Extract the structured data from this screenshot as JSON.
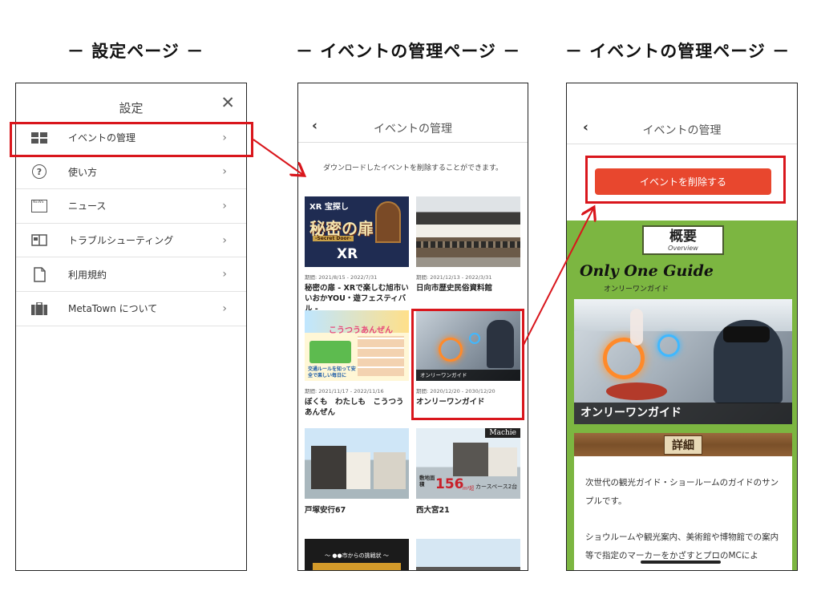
{
  "headings": {
    "settings": "－ 設定ページ －",
    "event_mgmt_1": "－ イベントの管理ページ －",
    "event_mgmt_2": "－ イベントの管理ページ －"
  },
  "settings": {
    "title": "設定",
    "close_icon": "close-icon",
    "menu": [
      {
        "label": "イベントの管理",
        "icon": "grid-icon"
      },
      {
        "label": "使い方",
        "icon": "help-circle-icon",
        "glyph": "?"
      },
      {
        "label": "ニュース",
        "icon": "news-icon",
        "glyph": "NEWS"
      },
      {
        "label": "トラブルシューティング",
        "icon": "book-icon"
      },
      {
        "label": "利用規約",
        "icon": "document-icon"
      },
      {
        "label": "MetaTown について",
        "icon": "briefcase-icon"
      }
    ],
    "chevron": "›"
  },
  "events": {
    "back": "‹",
    "title": "イベントの管理",
    "description": "ダウンロードしたイベントを削除することができます。",
    "cards": [
      {
        "period": "期間: 2021/8/15 - 2022/7/31",
        "title": "秘密の扉 - XRで楽しむ旭市いいおかYOU・遊フェスティバル -",
        "thumb": {
          "top": "XR 宝探し",
          "main": "秘密の扉",
          "sub": "-Secret Door-",
          "xr": "XR"
        }
      },
      {
        "period": "期間: 2021/12/13 - 2022/3/31",
        "title": "日向市歴史民俗資料館"
      },
      {
        "period": "期間: 2021/11/17 - 2022/11/16",
        "title": "ぼくも　わたしも　こうつうあんぜん",
        "thumb": {
          "main": "こうつうあんぜん",
          "sub": "交通ルールを知って安全で楽しい毎日に"
        }
      },
      {
        "period": "期間: 2020/12/20 - 2030/12/20",
        "title": "オンリーワンガイド",
        "thumb": {
          "caption": "オンリーワンガイド"
        }
      },
      {
        "title": "戸塚安行67"
      },
      {
        "title": "西大宮21",
        "thumb": {
          "brand": "Machie",
          "area_label": "敷地面積",
          "area_value": "156",
          "area_unit": "m²超",
          "note": "カースペース2台"
        }
      },
      {
        "thumb": {
          "text": "～ ●●市からの挑戦状 ～"
        }
      },
      {}
    ]
  },
  "detail": {
    "back": "‹",
    "title": "イベントの管理",
    "delete_button": "イベントを削除する",
    "overview_big": "概要",
    "overview_small": "Overview",
    "guide_en": "Only One Guide",
    "guide_jp": "オンリーワンガイド",
    "hero_caption": "オンリーワンガイド",
    "details_label": "詳細",
    "paragraphs": [
      "次世代の観光ガイド・ショールームのガイドのサンプルです。",
      "ショウルームや観光案内、美術館や博物館での案内等で指定のマーカーをかざすとプロのMCによ"
    ]
  },
  "colors": {
    "highlight": "#d9161c",
    "delete_button": "#e8472e",
    "detail_background": "#7cb641"
  }
}
